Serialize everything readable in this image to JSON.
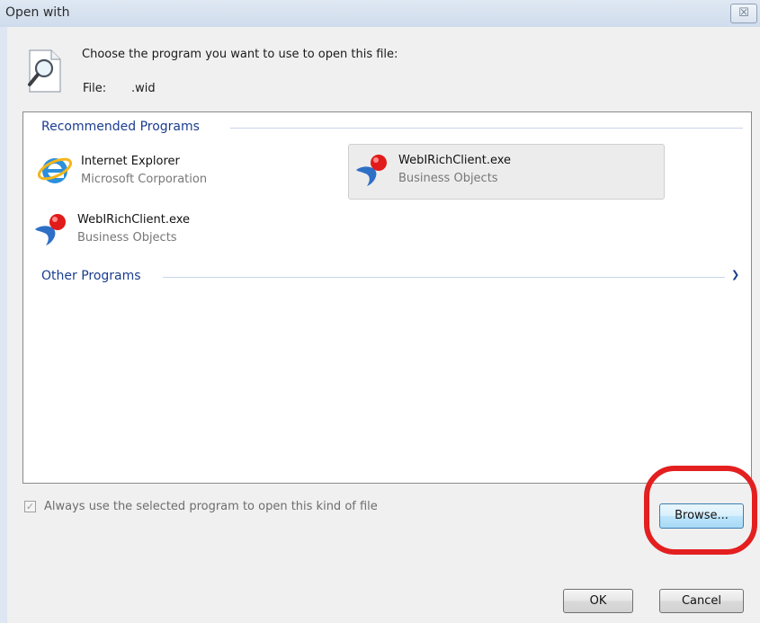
{
  "window": {
    "title": "Open with",
    "close_glyph": "☒"
  },
  "header": {
    "prompt": "Choose the program you want to use to open this file:",
    "file_label": "File:",
    "file_name": ".wid"
  },
  "groups": {
    "recommended": "Recommended Programs",
    "other": "Other Programs"
  },
  "programs": [
    {
      "name": "Internet Explorer",
      "publisher": "Microsoft Corporation",
      "icon": "internet-explorer-icon",
      "selected": false
    },
    {
      "name": "WebIRichClient.exe",
      "publisher": "Business Objects",
      "icon": "webi-rich-client-icon",
      "selected": true
    },
    {
      "name": "WebIRichClient.exe",
      "publisher": "Business Objects",
      "icon": "webi-rich-client-icon",
      "selected": false
    }
  ],
  "always_use": {
    "label": "Always use the selected program to open this kind of file",
    "checked": true
  },
  "buttons": {
    "browse": "Browse...",
    "ok": "OK",
    "cancel": "Cancel"
  },
  "colors": {
    "group_header": "#1a3d8f",
    "highlight": "#e31f1f"
  }
}
